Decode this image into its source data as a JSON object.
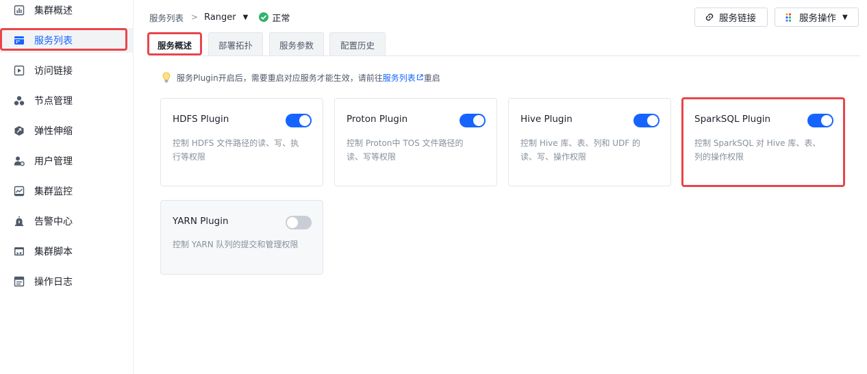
{
  "sidebar": {
    "items": [
      {
        "label": "集群概述",
        "icon": "bar-chart-icon",
        "active": false
      },
      {
        "label": "服务列表",
        "icon": "service-list-icon",
        "active": true
      },
      {
        "label": "访问链接",
        "icon": "play-link-icon",
        "active": false
      },
      {
        "label": "节点管理",
        "icon": "nodes-icon",
        "active": false
      },
      {
        "label": "弹性伸缩",
        "icon": "scaling-icon",
        "active": false
      },
      {
        "label": "用户管理",
        "icon": "user-gear-icon",
        "active": false
      },
      {
        "label": "集群监控",
        "icon": "monitor-icon",
        "active": false
      },
      {
        "label": "告警中心",
        "icon": "alarm-icon",
        "active": false
      },
      {
        "label": "集群脚本",
        "icon": "script-icon",
        "active": false
      },
      {
        "label": "操作日志",
        "icon": "log-icon",
        "active": false
      }
    ]
  },
  "breadcrumb": {
    "parent": "服务列表",
    "separator": ">",
    "service": "Ranger",
    "status": "正常"
  },
  "header": {
    "service_link_label": "服务链接",
    "service_ops_label": "服务操作"
  },
  "tabs": [
    {
      "label": "服务概述",
      "active": true
    },
    {
      "label": "部署拓扑",
      "active": false
    },
    {
      "label": "服务参数",
      "active": false
    },
    {
      "label": "配置历史",
      "active": false
    }
  ],
  "notice": {
    "text_before": "服务Plugin开启后，需要重启对应服务才能生效，请前往",
    "link_text": "服务列表",
    "text_after": "重启"
  },
  "plugins": [
    {
      "title": "HDFS Plugin",
      "desc": "控制 HDFS 文件路径的读、写、执\n行等权限",
      "enabled": true
    },
    {
      "title": "Proton Plugin",
      "desc": "控制 Proton中 TOS 文件路径的\n读、写等权限",
      "enabled": true
    },
    {
      "title": "Hive Plugin",
      "desc": "控制 Hive 库、表、列和 UDF 的\n读、写、操作权限",
      "enabled": true
    },
    {
      "title": "SparkSQL Plugin",
      "desc": "控制 SparkSQL 对 Hive 库、表、\n列的操作权限",
      "enabled": true
    },
    {
      "title": "YARN Plugin",
      "desc": "控制 YARN 队列的提交和管理权限",
      "enabled": false
    }
  ],
  "colors": {
    "accent": "#1664ff",
    "status_ok": "#33b36b",
    "highlight": "#e8454a",
    "toggle_off": "#c9cdd4"
  }
}
